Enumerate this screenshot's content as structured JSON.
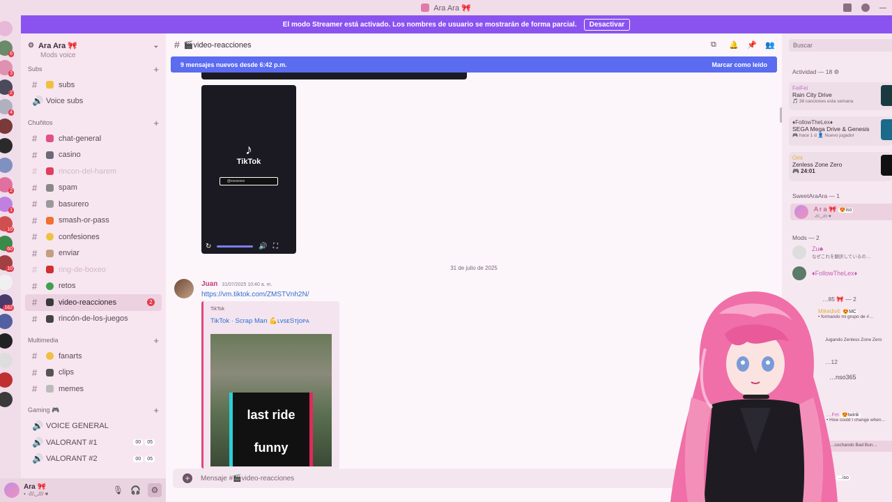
{
  "window": {
    "title": "Ara Ara 🎀"
  },
  "banner": {
    "text": "El modo Streamer está activado. Los nombres de usuario se mostrarán de forma parcial.",
    "button": "Desactivar"
  },
  "server": {
    "name": "Ara Ara 🎀",
    "cut_item": "Mods voice"
  },
  "categories": [
    {
      "name": "Subs",
      "channels": [
        {
          "label": "subs",
          "type": "text"
        },
        {
          "label": "Voice subs",
          "type": "voice"
        }
      ]
    },
    {
      "name": "Chuñitos",
      "channels": [
        {
          "label": "chat-general"
        },
        {
          "label": "casino"
        },
        {
          "label": "rincon-del-harem",
          "muted": true
        },
        {
          "label": "spam"
        },
        {
          "label": "basurero"
        },
        {
          "label": "smash-or-pass"
        },
        {
          "label": "confesiones"
        },
        {
          "label": "enviar"
        },
        {
          "label": "ring-de-boxeo",
          "muted": true
        },
        {
          "label": "retos"
        },
        {
          "label": "video-reacciones",
          "active": true,
          "badge": "2"
        },
        {
          "label": "rincón-de-los-juegos"
        }
      ]
    },
    {
      "name": "Multimedia",
      "channels": [
        {
          "label": "fanarts"
        },
        {
          "label": "clips"
        },
        {
          "label": "memes"
        }
      ]
    },
    {
      "name": "Gaming 🎮",
      "channels": [
        {
          "label": "VOICE GENERAL",
          "type": "voice"
        },
        {
          "label": "VALORANT #1",
          "type": "voice",
          "counts": [
            "00",
            "05"
          ]
        },
        {
          "label": "VALORANT #2",
          "type": "voice",
          "counts": [
            "00",
            "05"
          ]
        }
      ]
    }
  ],
  "user": {
    "name": "Ara 🎀",
    "status": "• ·///◡///·♥"
  },
  "channel_header": {
    "name": "🎬video-reacciones"
  },
  "new_messages": {
    "text": "9 mensajes nuevos desde 6:42 p.m.",
    "mark": "Marcar como leído"
  },
  "video": {
    "brand": "TikTok",
    "search_tag": "@xxxxxxxx"
  },
  "date_divider": "31 de julio de 2025",
  "message": {
    "author": "Juan",
    "time": "31/07/2025 10:40 a. m.",
    "link": "https://vm.tiktok.com/ZMSTVnh2N/",
    "embed_provider": "TikTok",
    "embed_title": "TikTok · Scrap Man 💪ʟᴠsᴇSᴛjᴏᴘᴀ",
    "thumb_line1": "last ride",
    "thumb_line2": "funny"
  },
  "composer": {
    "placeholder": "Mensaje #🎬video-reacciones"
  },
  "members": {
    "search": "Buscar",
    "activity_header": "Actividad — 18 ⚙",
    "activities": [
      {
        "name": "FeiFei",
        "game": "Rain City Drive",
        "sub": "🎵 38 canciones esta semana"
      },
      {
        "name": "♦FollowTheLex♦",
        "game": "SEGA Mega Drive & Genesis",
        "sub": "🎮 hace 1 d  👤 Nuevo jugador"
      },
      {
        "name": "Omi",
        "game": "Zenless Zone Zero",
        "sub": "🎮 24:01"
      }
    ],
    "group1": "SweetAraAra — 1",
    "group1_member": "A r a 🎀",
    "group1_tag": "😍iso",
    "group1_status": "·///◡///·♥",
    "group2": "Mods — 2",
    "mods": [
      {
        "name": "Zu♣",
        "sub": "なぜこれを翻訳しているの…"
      },
      {
        "name": "♦FollowTheLex♦",
        "sub": ""
      }
    ],
    "group3": "…85 🎀 — 2",
    "g3_member1": "Mikedivit",
    "g3_member1_tag": "😍MC",
    "g3_member1_sub": "• formando mi grupo de #…",
    "g3_member2_sub": "Jugando Zenless Zone Zero",
    "g4": "…12",
    "g4_member": "…nso365",
    "g4_member2": "…Fei",
    "g4_member2_tag": "😍twink",
    "g4_member2_sub": "• How could I change when…",
    "g4_member3_sub": "…cuchando Bad Bun…",
    "g4_member4_tag": "…iso"
  },
  "colors": {
    "accent": "#8a53f0",
    "new_bar": "#5b6cf0",
    "badge": "#e23b4a",
    "link": "#2c6fd0"
  }
}
